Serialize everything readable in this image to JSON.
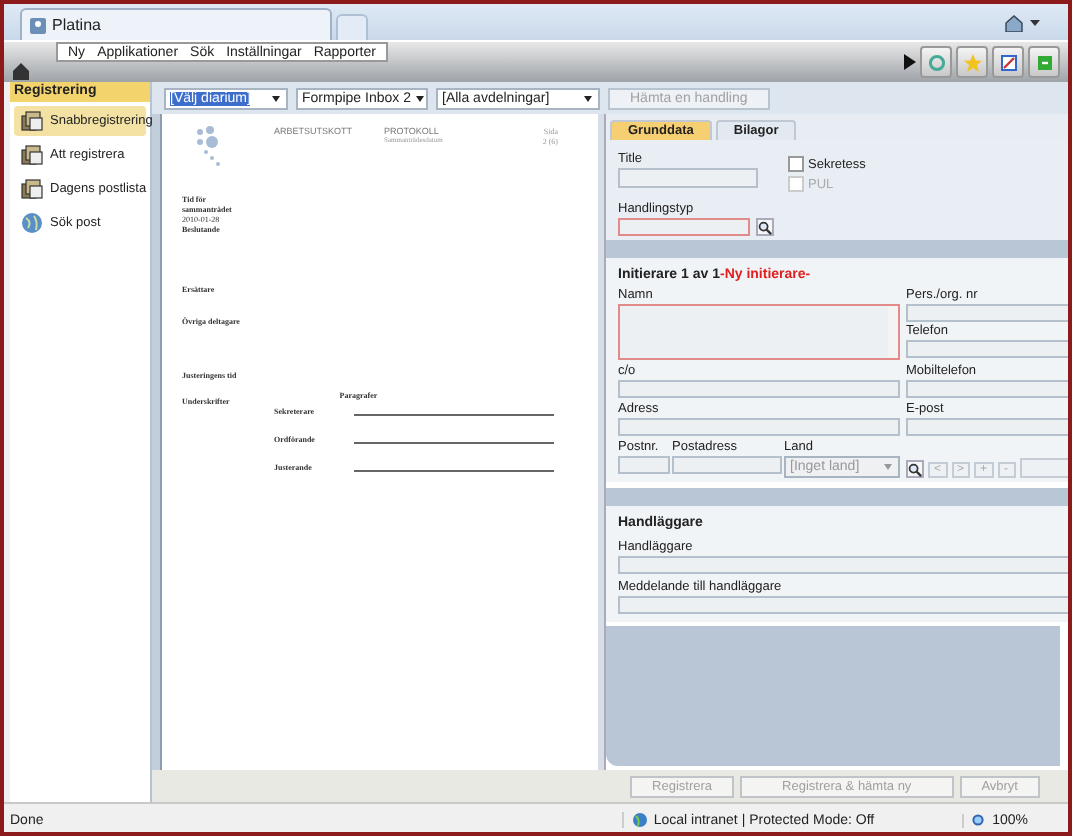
{
  "browser": {
    "tab_title": "Platina"
  },
  "menu": [
    {
      "label": "Ny"
    },
    {
      "label": "Applikationer"
    },
    {
      "label": "Sök"
    },
    {
      "label": "Inställningar"
    },
    {
      "label": "Rapporter"
    }
  ],
  "sidebar": {
    "title": "Registrering",
    "items": [
      {
        "label": "Snabbregistrering",
        "selected": true
      },
      {
        "label": "Att registrera",
        "selected": false
      },
      {
        "label": "Dagens postlista",
        "selected": false
      },
      {
        "label": "Sök post",
        "selected": false
      }
    ]
  },
  "toolbar": {
    "selects": [
      {
        "value": "[Välj diarium]",
        "focused": true
      },
      {
        "value": "Formpipe Inbox 2",
        "focused": false
      },
      {
        "value": "[Alla avdelningar]",
        "focused": false
      }
    ],
    "fetch_button": {
      "label": "Hämta en handling",
      "disabled": true
    }
  },
  "document": {
    "org": "ARBETSUTSKOTT",
    "type": "PROTOKOLL",
    "subtitle": "Sammanträdesdatum",
    "page_label": "Sida",
    "page": "2 (6)",
    "meta": [
      "Tid för",
      "sammanträdet",
      "2010-01-28",
      "Beslutande"
    ],
    "sections": [
      "Ersättare",
      "Övriga deltagare",
      "Justeringens tid",
      "Underskrifter"
    ],
    "paragraphs_label": "Paragrafer",
    "signers": [
      "Sekreterare",
      "Ordförande",
      "Justerande"
    ]
  },
  "form": {
    "tabs": [
      {
        "label": "Grunddata",
        "selected": true
      },
      {
        "label": "Bilagor",
        "selected": false
      }
    ],
    "title_label": "Title",
    "checkboxes": [
      {
        "label": "Sekretess",
        "checked": false,
        "disabled": false
      },
      {
        "label": "PUL",
        "checked": false,
        "disabled": true
      }
    ],
    "type_label": "Handlingstyp",
    "initiator": {
      "heading": "Initierare 1 av 1",
      "status": "-Ny initierare-"
    },
    "name_label": "Namn",
    "right_fields": [
      "Pers./org. nr",
      "Telefon"
    ],
    "rows": [
      [
        "c/o",
        "Mobiltelefon"
      ],
      [
        "Adress",
        "E-post"
      ]
    ],
    "postal": {
      "zip": "Postnr.",
      "city": "Postadress",
      "country_label": "Land",
      "country": "[Inget land]"
    },
    "nav_buttons": [
      "<",
      ">",
      "+",
      "-"
    ],
    "handler": {
      "heading": "Handläggare",
      "fields": [
        "Handläggare",
        "Meddelande till handläggare"
      ]
    }
  },
  "buttons": [
    {
      "label": "Registrera",
      "disabled": true
    },
    {
      "label": "Registrera & hämta ny",
      "disabled": true
    },
    {
      "label": "Avbryt",
      "disabled": true
    }
  ],
  "status_bar": {
    "text": "Done",
    "zone": "Local intranet | Protected Mode: Off",
    "zoom": "100%"
  }
}
